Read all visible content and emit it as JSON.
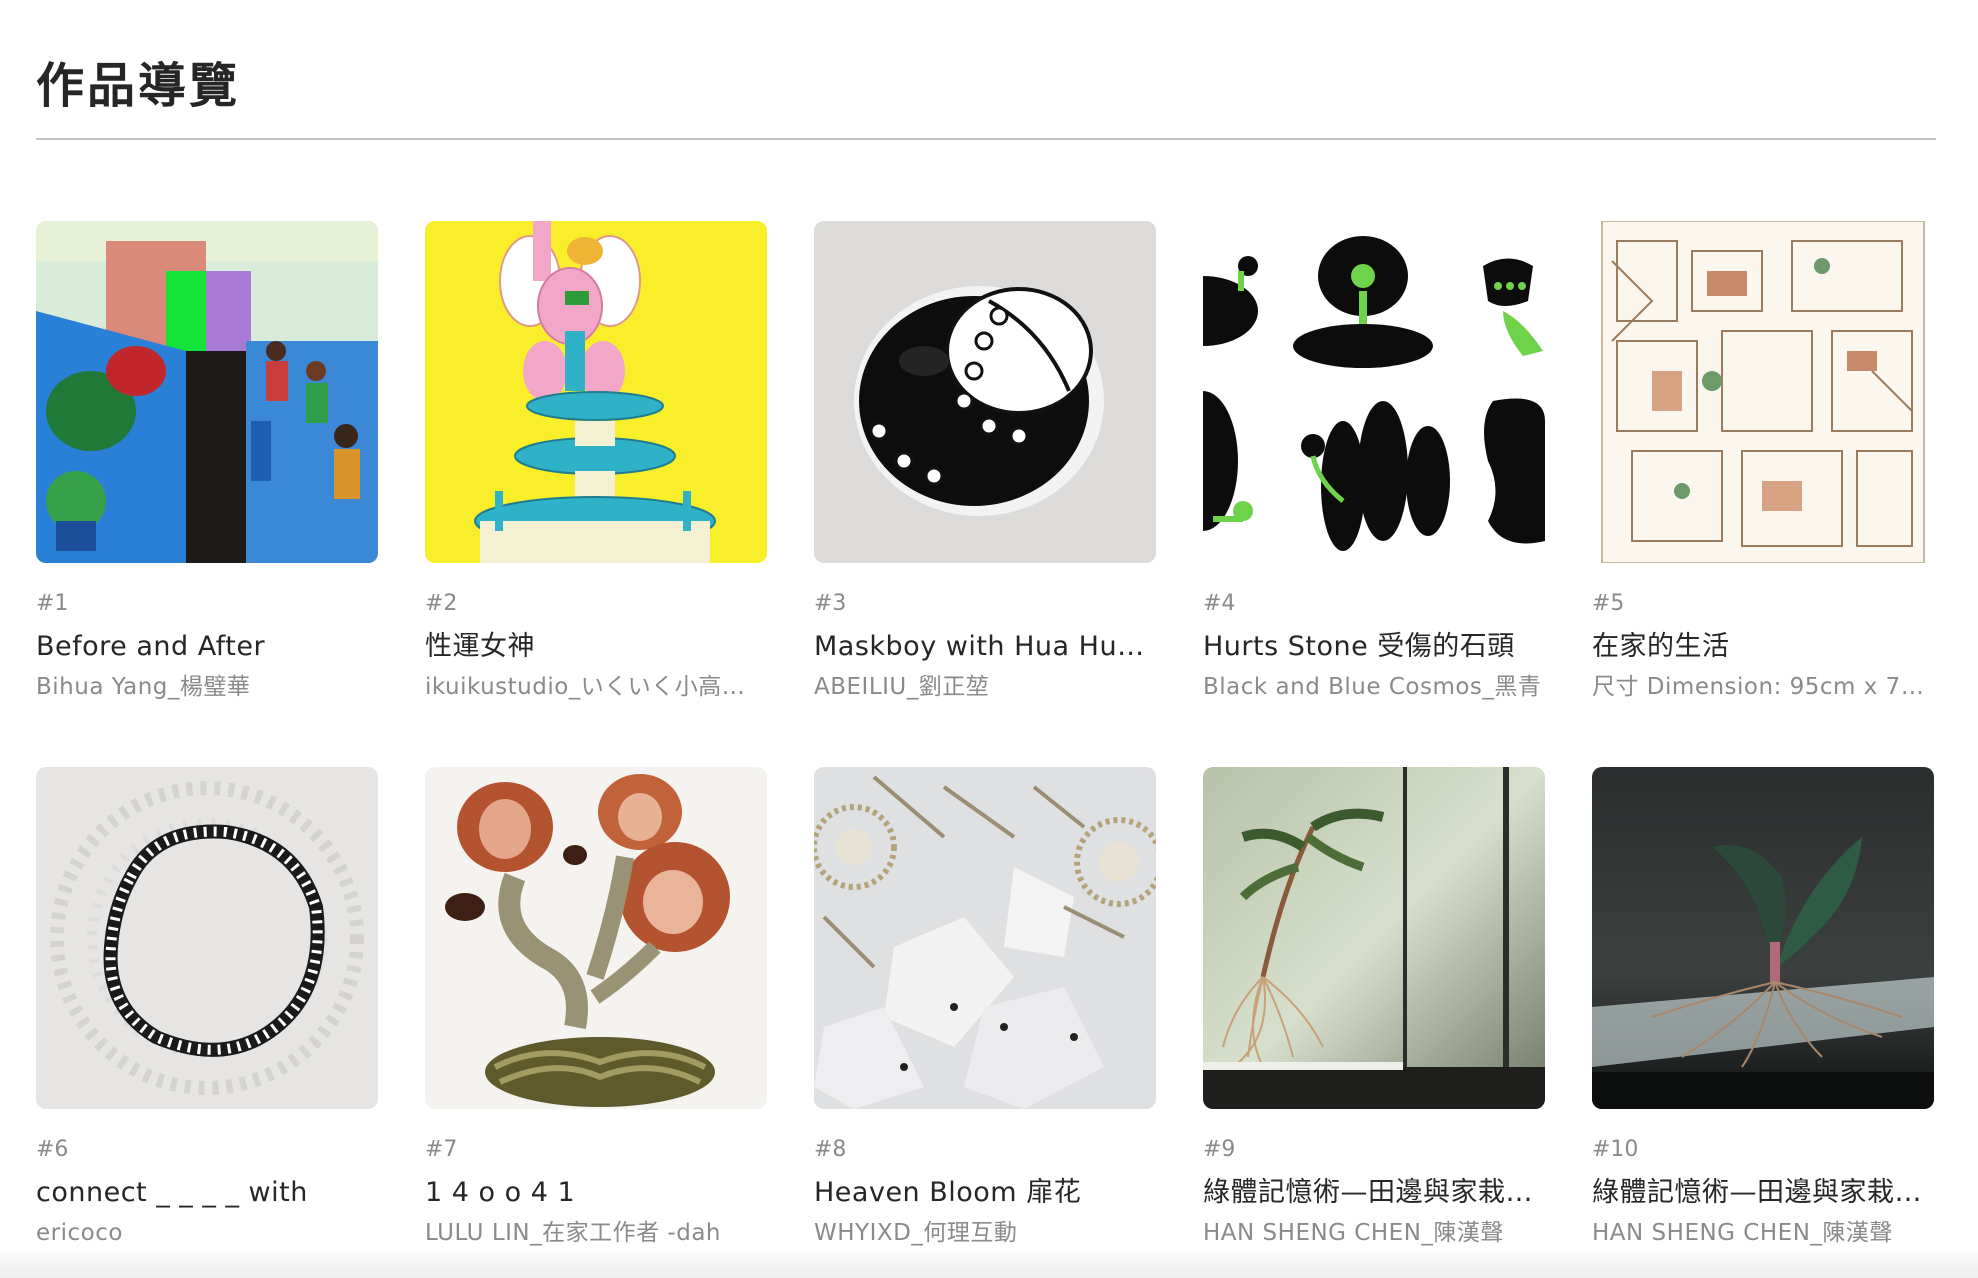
{
  "page": {
    "title": "作品導覽"
  },
  "works": [
    {
      "number": "#1",
      "title": "Before and After",
      "artist": "Bihua Yang_楊璧華",
      "image": "airplane-cabin-plants-illustration"
    },
    {
      "number": "#2",
      "title": "性運女神",
      "artist": "ikuikustudio_いくいく小高…",
      "image": "pink-figure-fountain-illustration"
    },
    {
      "number": "#3",
      "title": "Maskboy with Hua Hua…",
      "artist": "ABEILIU_劉正堃",
      "image": "mask-face-flowers-artwork"
    },
    {
      "number": "#4",
      "title": "Hurts Stone 受傷的石頭",
      "artist": "Black and Blue Cosmos_黑青",
      "image": "black-stones-green-flowers-artwork"
    },
    {
      "number": "#5",
      "title": "在家的生活",
      "artist": "尺寸 Dimension: 95cm x 70…",
      "image": "house-interior-line-drawing"
    },
    {
      "number": "#6",
      "title": "connect _ _ _ _ with",
      "artist": "ericoco",
      "image": "ring-of-figures-drawing"
    },
    {
      "number": "#7",
      "title": "1 4 o o 4 1",
      "artist": "LULU LIN_在家工作者 -dah",
      "image": "rose-faces-painting"
    },
    {
      "number": "#8",
      "title": "Heaven Bloom 扉花",
      "artist": "WHYIXD_何理互動",
      "image": "kinetic-flower-installation"
    },
    {
      "number": "#9",
      "title": "綠體記憶術—田邊與家栽…",
      "artist": "HAN SHENG CHEN_陳漢聲",
      "image": "plant-roots-glass-installation"
    },
    {
      "number": "#10",
      "title": "綠體記憶術—田邊與家栽…",
      "artist": "HAN SHENG CHEN_陳漢聲",
      "image": "plant-roots-lit-installation"
    }
  ],
  "colors": {
    "title_text": "#262626",
    "meta_text": "#8a8a8a",
    "divider": "#c2c2c2"
  }
}
